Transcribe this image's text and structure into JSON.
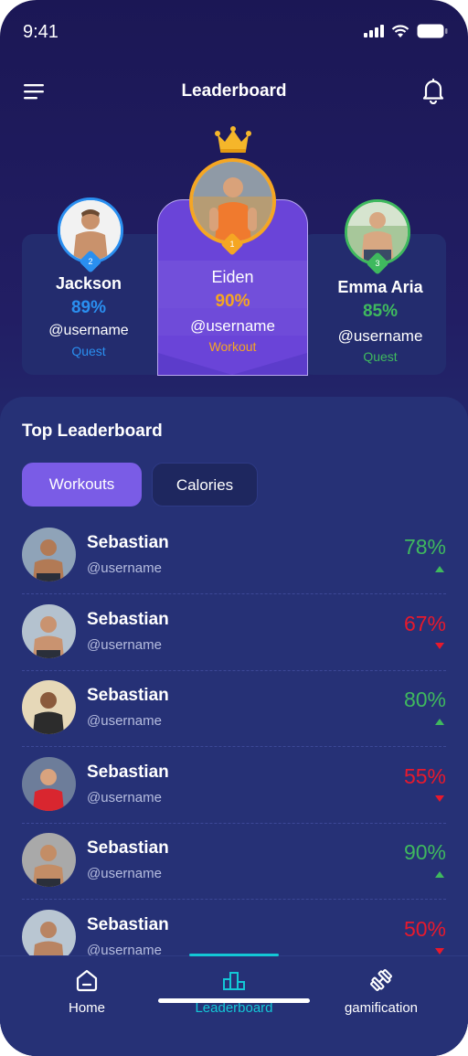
{
  "status_bar": {
    "time": "9:41"
  },
  "header": {
    "title": "Leaderboard"
  },
  "podium": {
    "first": {
      "rank": "1",
      "name": "Eiden",
      "percent": "90%",
      "username": "@username",
      "tag": "Workout"
    },
    "second": {
      "rank": "2",
      "name": "Jackson",
      "percent": "89%",
      "username": "@username",
      "tag": "Quest"
    },
    "third": {
      "rank": "3",
      "name": "Emma Aria",
      "percent": "85%",
      "username": "@username",
      "tag": "Quest"
    }
  },
  "list": {
    "title": "Top Leaderboard",
    "tabs": [
      {
        "label": "Workouts"
      },
      {
        "label": "Calories"
      }
    ],
    "rows": [
      {
        "name": "Sebastian",
        "username": "@username",
        "percent": "78%",
        "trend": "up"
      },
      {
        "name": "Sebastian",
        "username": "@username",
        "percent": "67%",
        "trend": "down"
      },
      {
        "name": "Sebastian",
        "username": "@username",
        "percent": "80%",
        "trend": "up"
      },
      {
        "name": "Sebastian",
        "username": "@username",
        "percent": "55%",
        "trend": "down"
      },
      {
        "name": "Sebastian",
        "username": "@username",
        "percent": "90%",
        "trend": "up"
      },
      {
        "name": "Sebastian",
        "username": "@username",
        "percent": "50%",
        "trend": "down"
      }
    ]
  },
  "nav": {
    "items": [
      {
        "label": "Home"
      },
      {
        "label": "Leaderboard"
      },
      {
        "label": "gamification"
      }
    ]
  },
  "colors": {
    "accent_purple": "#7a5ce6",
    "gold": "#f5a623",
    "blue": "#2a8ff0",
    "green": "#3fb95e",
    "red": "#e8192c",
    "teal": "#13c7d6"
  },
  "icons": {
    "menu": "menu-icon",
    "bell": "bell-icon",
    "crown": "crown-icon",
    "home": "home-icon",
    "leaderboard": "podium-icon",
    "gamification": "dumbbell-icon"
  }
}
